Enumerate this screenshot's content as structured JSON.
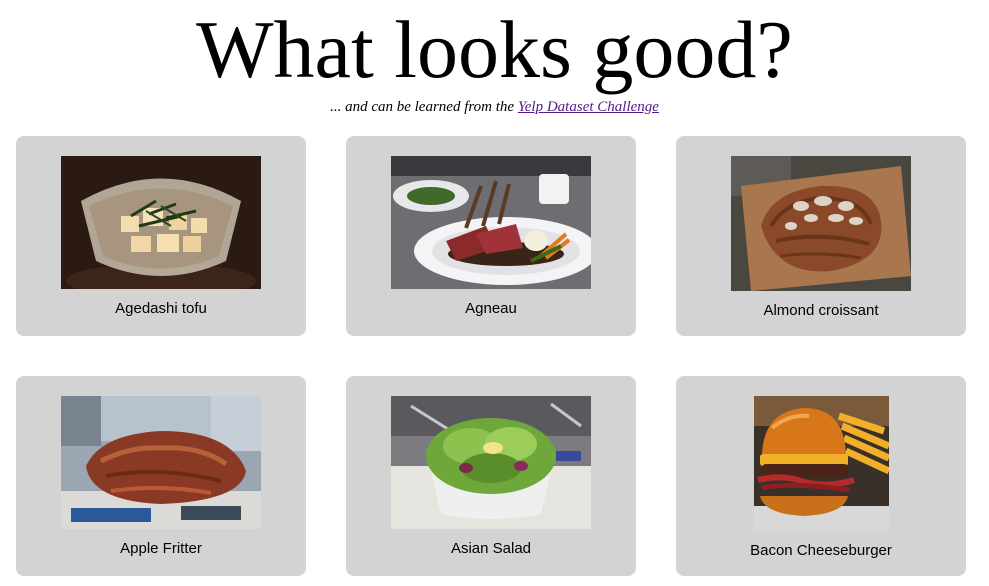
{
  "header": {
    "title": "What looks good?",
    "subtitle_prefix": "... and can be learned from the ",
    "subtitle_link": "Yelp Dataset Challenge"
  },
  "dishes": [
    {
      "name": "Agedashi tofu",
      "icon": "agedashi-tofu-photo"
    },
    {
      "name": "Agneau",
      "icon": "agneau-photo"
    },
    {
      "name": "Almond croissant",
      "icon": "almond-croissant-photo"
    },
    {
      "name": "Apple Fritter",
      "icon": "apple-fritter-photo"
    },
    {
      "name": "Asian Salad",
      "icon": "asian-salad-photo"
    },
    {
      "name": "Bacon Cheeseburger",
      "icon": "bacon-cheeseburger-photo"
    }
  ],
  "colors": {
    "card_background": "#d3d3d3",
    "link": "#551a8b"
  }
}
